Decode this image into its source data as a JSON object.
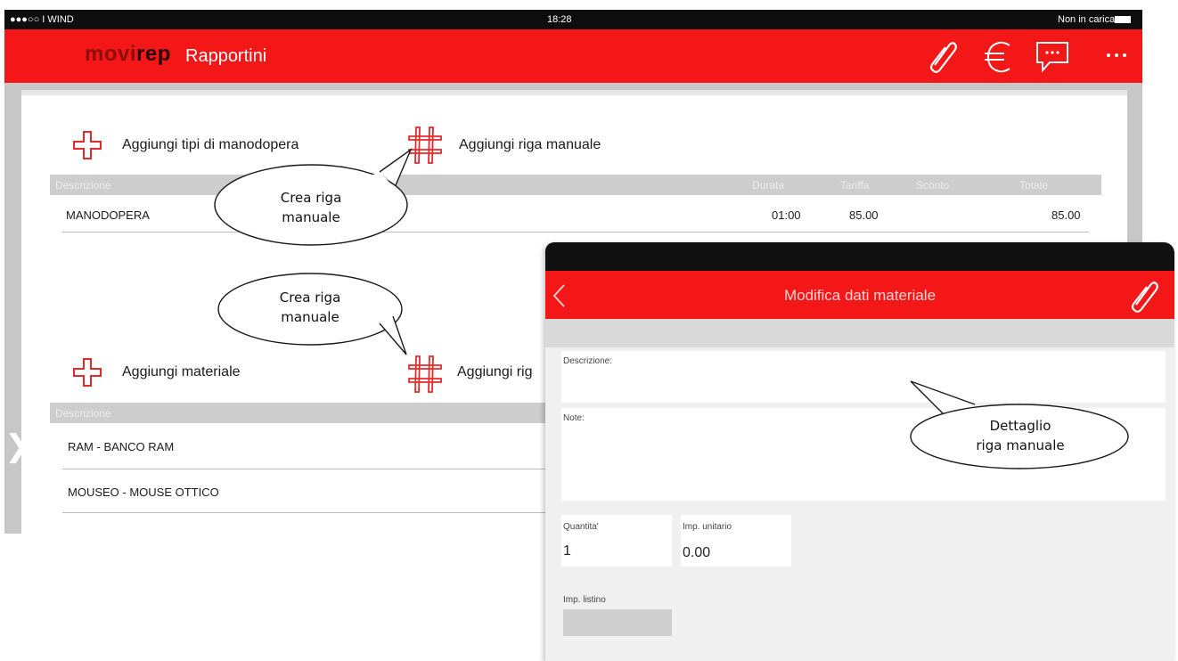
{
  "status_bar": {
    "carrier": "●●●○○ I WIND",
    "time": "18:28",
    "battery": "Non in carica"
  },
  "app_bar": {
    "logo_part1": "movi",
    "logo_part2": "rep",
    "title": "Rapportini",
    "icons": [
      "paperclip-icon",
      "euro-icon",
      "chat-icon",
      "more-icon"
    ]
  },
  "labor": {
    "add_types_label": "Aggiungi tipi di manodopera",
    "add_manual_label": "Aggiungi riga manuale",
    "columns": [
      "Descrizione",
      "Durata",
      "Tariffa",
      "Sconto",
      "Totale"
    ],
    "rows": [
      {
        "descrizione": "MANODOPERA",
        "durata": "01:00",
        "tariffa": "85.00",
        "sconto": "",
        "totale": "85.00"
      }
    ]
  },
  "material": {
    "add_material_label": "Aggiungi materiale",
    "add_manual_label": "Aggiungi rig",
    "columns": [
      "Descrizione"
    ],
    "rows": [
      "RAM - BANCO RAM",
      "MOUSEO - MOUSE OTTICO"
    ]
  },
  "panel": {
    "title": "Modifica dati materiale",
    "fields": {
      "descrizione_label": "Descrizione:",
      "note_label": "Note:",
      "quantita_label": "Quantita'",
      "quantita_value": "1",
      "imp_unitario_label": "Imp. unitario",
      "imp_unitario_value": "0.00",
      "imp_listino_label": "Imp. listino"
    }
  },
  "callouts": {
    "first": [
      "Crea riga",
      "manuale"
    ],
    "second": [
      "Crea riga",
      "manuale"
    ],
    "third": [
      "Dettaglio",
      "riga manuale"
    ]
  }
}
